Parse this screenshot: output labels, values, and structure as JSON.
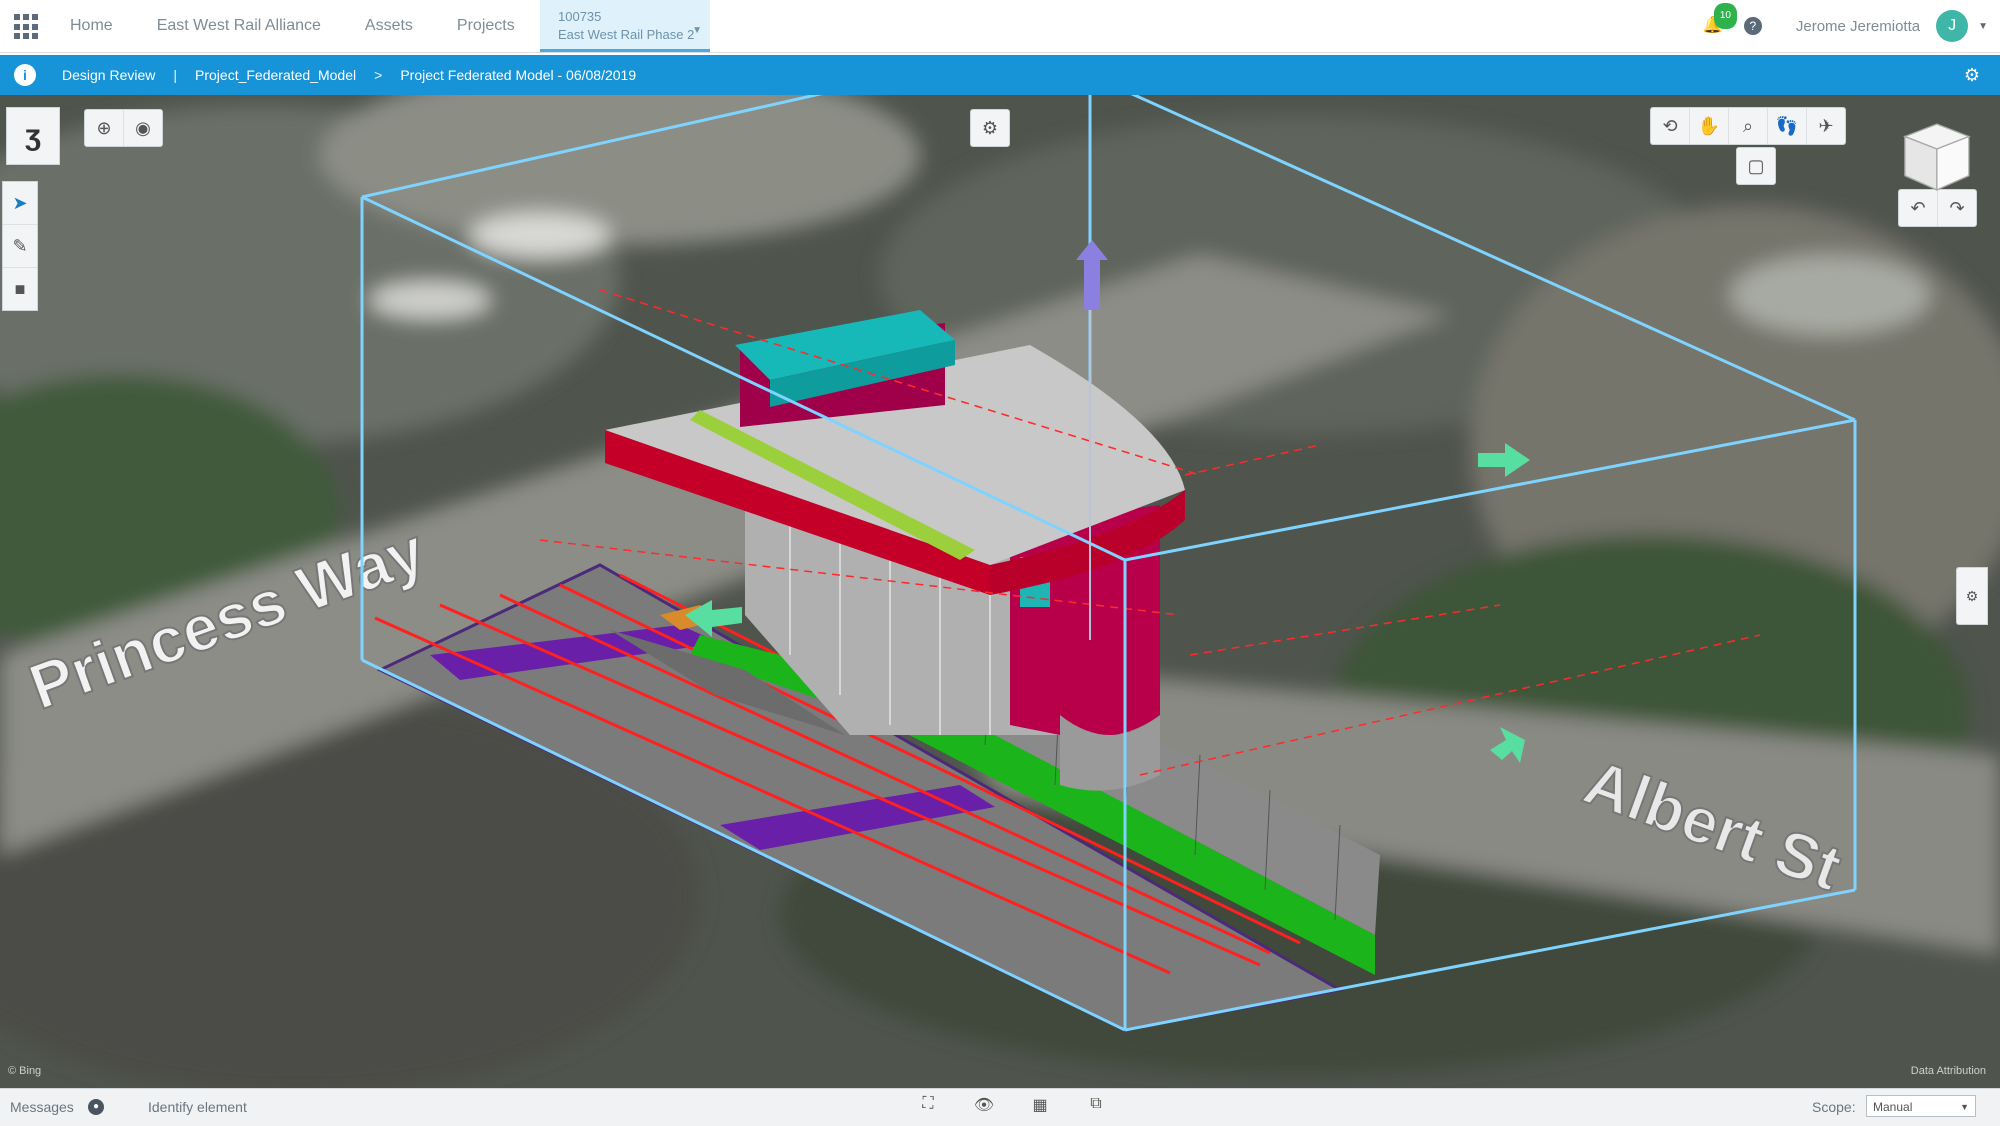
{
  "topbar": {
    "nav": [
      "Home",
      "East West Rail Alliance",
      "Assets",
      "Projects"
    ],
    "active_tab": {
      "line1": "100735",
      "line2": "East West Rail Phase 2"
    },
    "notifications_count": "10",
    "user_name": "Jerome Jeremiotta",
    "user_initial": "J"
  },
  "breadcrumb": {
    "app": "Design Review",
    "model": "Project_Federated_Model",
    "version": "Project Federated Model - 06/08/2019"
  },
  "map": {
    "street_1": "Princess Way",
    "street_2": "Albert St",
    "credit_left": "© Bing",
    "credit_right": "Data Attribution"
  },
  "statusbar": {
    "messages_label": "Messages",
    "identify_label": "Identify element",
    "scope_label": "Scope:",
    "scope_value": "Manual"
  },
  "icons": {
    "logo": "app-logo-icon",
    "select": "select-arrow-icon",
    "measure": "measure-icon",
    "delete": "delete-icon"
  }
}
